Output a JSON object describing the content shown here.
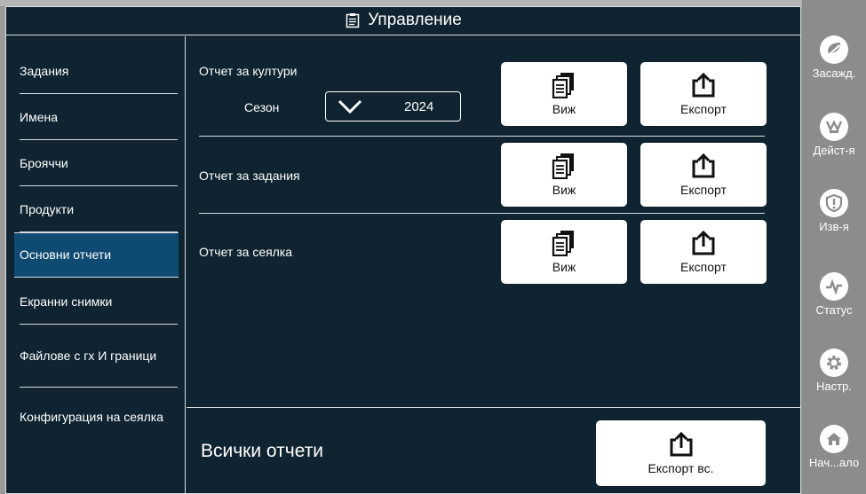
{
  "window": {
    "title": "Управление"
  },
  "sidebar": {
    "items": [
      {
        "label": "Задания"
      },
      {
        "label": "Имена"
      },
      {
        "label": "Брояччи"
      },
      {
        "label": "Продукти"
      },
      {
        "label": "Основни отчети",
        "active": true
      },
      {
        "label": "Екранни снимки"
      },
      {
        "label": "Файлове с гх И граници"
      },
      {
        "label": "Конфигурация на сеялка"
      }
    ]
  },
  "reports": {
    "crops": {
      "label": "Отчет за култури",
      "season_label": "Сезон",
      "season_value": "2024"
    },
    "tasks": {
      "label": "Отчет за задания"
    },
    "seeder": {
      "label": "Отчет за сеялка"
    },
    "view_label": "Виж",
    "export_label": "Експорт"
  },
  "bottom": {
    "title": "Всички отчети",
    "export_all_label": "Експорт вс."
  },
  "rightbar": {
    "items": [
      {
        "label": "Засажд.",
        "icon": "plant-icon"
      },
      {
        "label": "Дейст-я",
        "icon": "activity-icon"
      },
      {
        "label": "Изв-я",
        "icon": "alert-shield-icon"
      },
      {
        "label": "Статус",
        "icon": "pulse-icon"
      },
      {
        "label": "Настр.",
        "icon": "gear-icon"
      },
      {
        "label": "Нач...ало",
        "icon": "home-icon"
      }
    ]
  },
  "colors": {
    "background": "#0f2430",
    "active_item": "#0f4a73",
    "rightbar": "#8c8c8c",
    "line": "#d7dde1"
  }
}
